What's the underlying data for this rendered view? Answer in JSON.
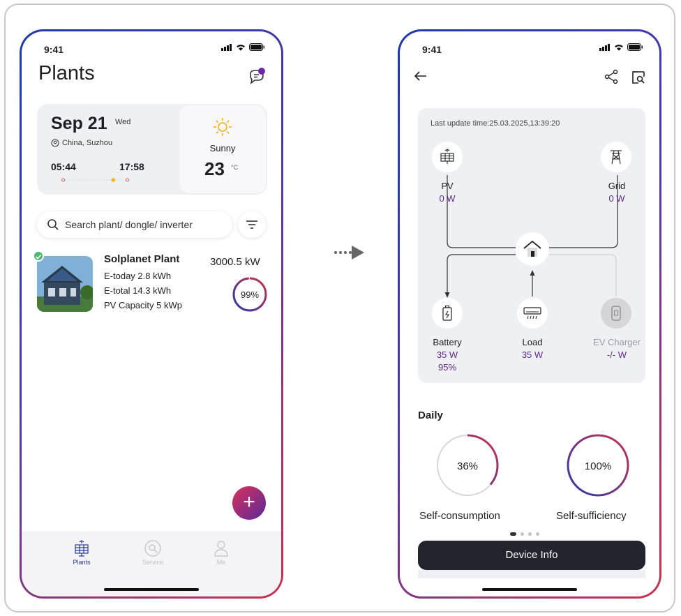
{
  "left_screen": {
    "status_time": "9:41",
    "title": "Plants",
    "date_card": {
      "date": "Sep 21",
      "weekday": "Wed",
      "location": "China, Suzhou",
      "sunrise": "05:44",
      "sunset": "17:58",
      "weather": "Sunny",
      "temperature": "23",
      "temp_unit": "°C"
    },
    "search": {
      "placeholder": "Search plant/ dongle/ inverter"
    },
    "plant": {
      "name": "Solplanet Plant",
      "power": "3000.5 kW",
      "e_today": "E-today 2.8 kWh",
      "e_total": "E-total 14.3 kWh",
      "pv_capacity": "PV Capacity  5 kWp",
      "ratio_label": "99%",
      "ratio": 0.99
    },
    "fab_label": "+",
    "tabs": [
      {
        "label": "Plants",
        "icon": "solar-panel-icon",
        "active": true
      },
      {
        "label": "Service",
        "icon": "wrench-search-icon",
        "active": false
      },
      {
        "label": "Me",
        "icon": "person-icon",
        "active": false
      }
    ]
  },
  "right_screen": {
    "status_time": "9:41",
    "last_update": "Last update time:25.03.2025,13:39:20",
    "nodes": {
      "pv": {
        "label": "PV",
        "value": "0 W"
      },
      "grid": {
        "label": "Grid",
        "value": "0 W"
      },
      "battery": {
        "label": "Battery",
        "value": "35 W",
        "soc": "95%"
      },
      "load": {
        "label": "Load",
        "value": "35 W"
      },
      "ev": {
        "label": "EV Charger",
        "value": "-/- W"
      }
    },
    "daily_title": "Daily",
    "self_consumption": {
      "label": "Self-consumption",
      "value": "36%",
      "fraction": 0.36
    },
    "self_sufficiency": {
      "label": "Self-sufficiency",
      "value": "100%",
      "fraction": 1.0
    },
    "device_button": "Device Info"
  },
  "colors": {
    "accent_purple": "#5c2a86",
    "gradient_start": "#1e3aa8",
    "gradient_end": "#c8324e",
    "badge_green": "#4cb873"
  }
}
